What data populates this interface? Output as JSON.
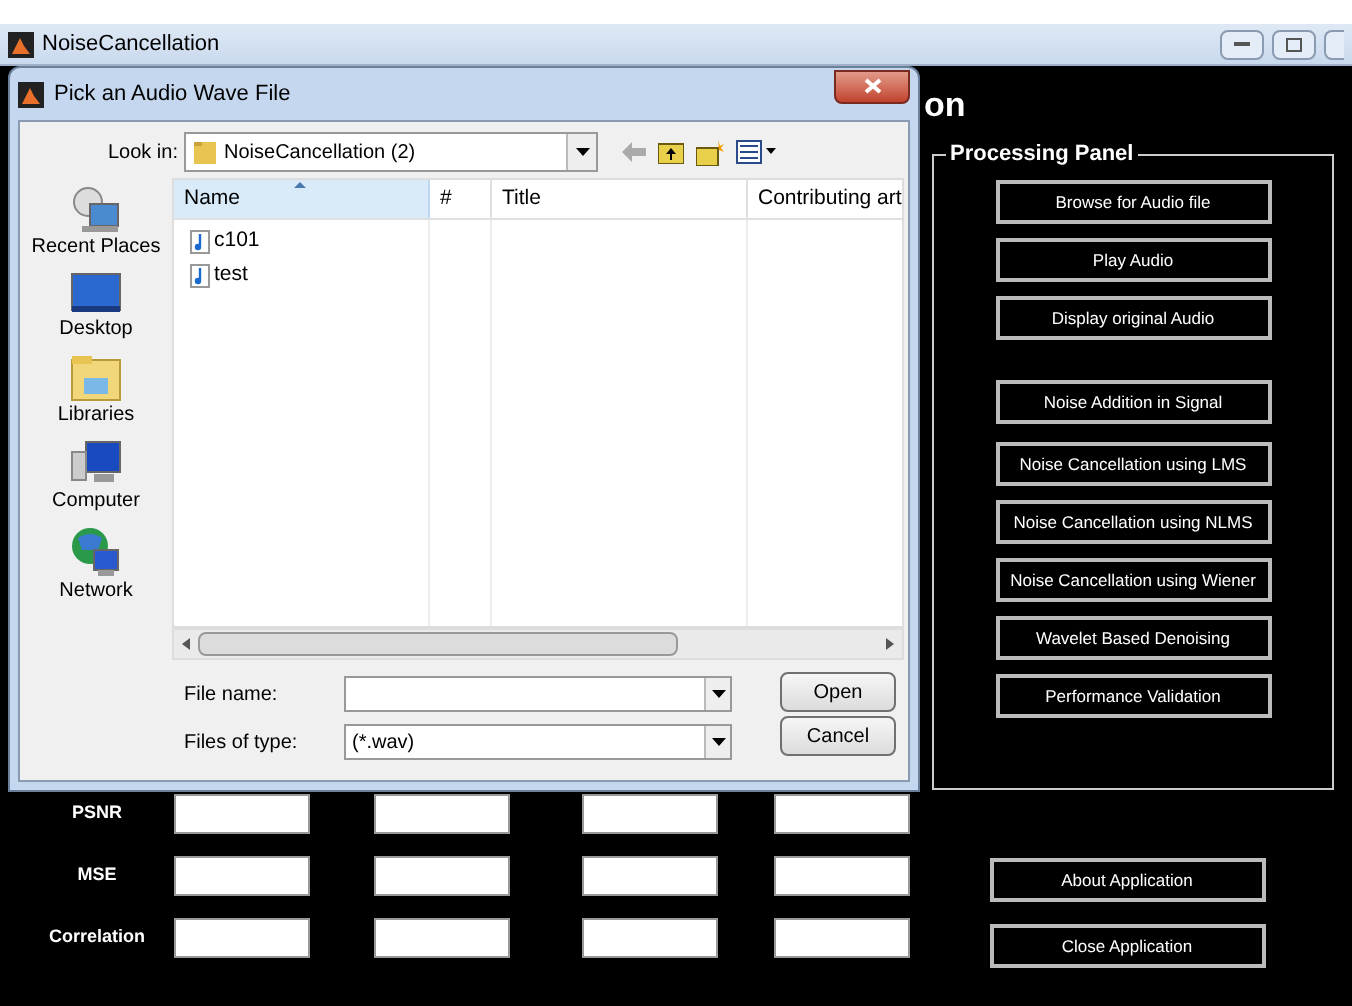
{
  "window": {
    "title": "NoiseCancellation",
    "heading": "on"
  },
  "dialog": {
    "title": "Pick an Audio Wave File",
    "look_in_label": "Look in:",
    "look_in_value": "NoiseCancellation (2)",
    "places": [
      {
        "label": "Recent Places",
        "kind": "recent"
      },
      {
        "label": "Desktop",
        "kind": "desktop"
      },
      {
        "label": "Libraries",
        "kind": "libraries"
      },
      {
        "label": "Computer",
        "kind": "computer"
      },
      {
        "label": "Network",
        "kind": "network"
      }
    ],
    "columns": [
      "Name",
      "#",
      "Title",
      "Contributing art"
    ],
    "files": [
      {
        "name": "c101"
      },
      {
        "name": "test"
      }
    ],
    "file_name_label": "File name:",
    "file_type_label": "Files of type:",
    "file_type_value": "(*.wav)",
    "buttons": [
      "Open",
      "Cancel"
    ]
  },
  "processing_panel": {
    "title": "Processing Panel",
    "buttons": [
      "Browse for Audio file",
      "Play Audio",
      "Display original Audio",
      "Noise Addition in Signal",
      "Noise Cancellation using LMS",
      "Noise Cancellation using NLMS",
      "Noise Cancellation using Wiener",
      "Wavelet Based Denoising",
      "Performance Validation"
    ]
  },
  "metrics": [
    "PSNR",
    "MSE",
    "Correlation"
  ],
  "app_buttons": [
    "About Application",
    "Close Application"
  ]
}
